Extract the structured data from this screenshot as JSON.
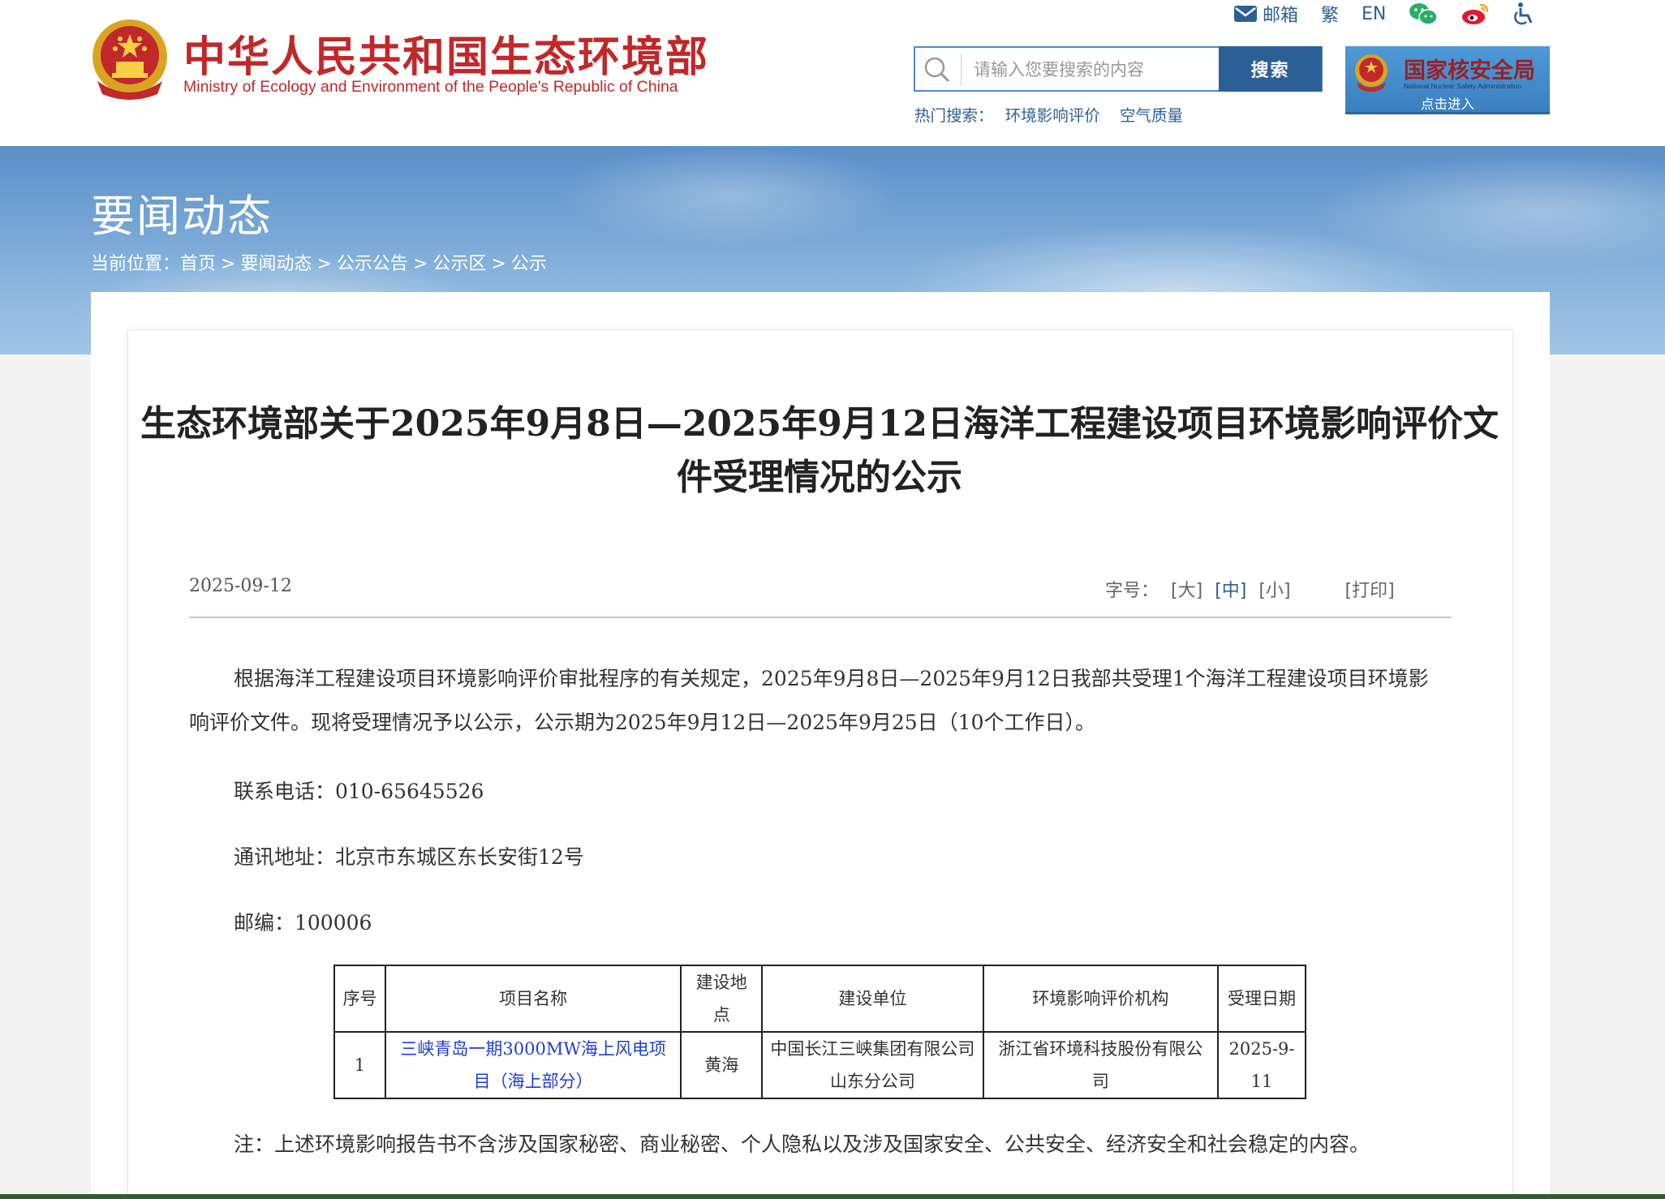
{
  "header": {
    "logo_cn": "中华人民共和国生态环境部",
    "logo_en": "Ministry of Ecology and Environment of the People's Republic of China",
    "top_links": {
      "mail": "邮箱",
      "traditional": "繁",
      "english": "EN"
    },
    "search": {
      "placeholder": "请输入您要搜索的内容",
      "button": "搜索"
    },
    "hot_search": {
      "label": "热门搜索：",
      "items": [
        "环境影响评价",
        "空气质量"
      ]
    },
    "nnsa": {
      "name_cn": "国家核安全局",
      "name_en": "National Nuclear Safety Administration",
      "enter": "点击进入"
    }
  },
  "banner": {
    "title": "要闻动态",
    "breadcrumb": {
      "label": "当前位置：",
      "items": [
        "首页",
        "要闻动态",
        "公示公告",
        "公示区",
        "公示"
      ],
      "separator": ">"
    }
  },
  "article": {
    "title": "生态环境部关于2025年9月8日—2025年9月12日海洋工程建设项目环境影响评价文件受理情况的公示",
    "date": "2025-09-12",
    "font_size": {
      "label": "字号：",
      "large": "[大]",
      "medium": "[中]",
      "small": "[小]",
      "print": "[打印]"
    },
    "paragraph": "根据海洋工程建设项目环境影响评价审批程序的有关规定，2025年9月8日—2025年9月12日我部共受理1个海洋工程建设项目环境影响评价文件。现将受理情况予以公示，公示期为2025年9月12日—2025年9月25日（10个工作日）。",
    "phone": "联系电话：010-65645526",
    "address": "通讯地址：北京市东城区东长安街12号",
    "postcode": "邮编：100006",
    "table": {
      "headers": [
        "序号",
        "项目名称",
        "建设地点",
        "建设单位",
        "环境影响评价机构",
        "受理日期"
      ],
      "rows": [
        [
          "1",
          "三峡青岛一期3000MW海上风电项目（海上部分）",
          "黄海",
          "中国长江三峡集团有限公司山东分公司",
          "浙江省环境科技股份有限公司",
          "2025-9-11"
        ]
      ]
    },
    "note": "注：上述环境影响报告书不含涉及国家秘密、商业秘密、个人隐私以及涉及国家安全、公共安全、经济安全和社会稳定的内容。"
  },
  "colors": {
    "brand_red": "#c0282a",
    "brand_blue": "#2d5f97",
    "link_blue": "#1f3fd0"
  }
}
